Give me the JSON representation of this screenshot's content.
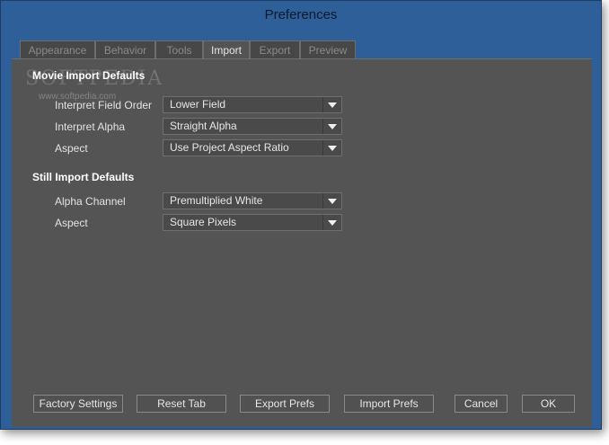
{
  "window": {
    "title": "Preferences"
  },
  "tabs": [
    {
      "label": "Appearance",
      "active": false
    },
    {
      "label": "Behavior",
      "active": false
    },
    {
      "label": "Tools",
      "active": false
    },
    {
      "label": "Import",
      "active": true
    },
    {
      "label": "Export",
      "active": false
    },
    {
      "label": "Preview",
      "active": false
    }
  ],
  "watermark": {
    "text": "SOFTPEDIA",
    "url": "www.softpedia.com"
  },
  "movie_section": {
    "title": "Movie Import Defaults",
    "rows": [
      {
        "label": "Interpret Field Order",
        "value": "Lower Field"
      },
      {
        "label": "Interpret Alpha",
        "value": "Straight Alpha"
      },
      {
        "label": "Aspect",
        "value": "Use Project Aspect Ratio"
      }
    ]
  },
  "still_section": {
    "title": "Still Import Defaults",
    "rows": [
      {
        "label": "Alpha Channel",
        "value": "Premultiplied White"
      },
      {
        "label": "Aspect",
        "value": "Square Pixels"
      }
    ]
  },
  "buttons": {
    "factory": "Factory Settings",
    "reset_tab": "Reset Tab",
    "export_prefs": "Export Prefs",
    "import_prefs": "Import Prefs",
    "cancel": "Cancel",
    "ok": "OK"
  },
  "icons": {
    "dropdown": "chevron-down-icon"
  },
  "colors": {
    "title_bar": "#2f5f99",
    "panel": "#545454",
    "text": "#e6e6e6"
  }
}
